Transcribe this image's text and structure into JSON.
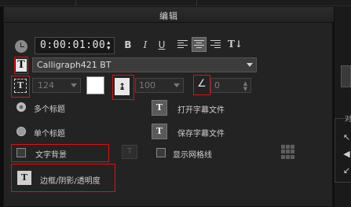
{
  "panel": {
    "title": "编辑"
  },
  "timecode": {
    "value": "0:00:01:00"
  },
  "font": {
    "selected": "Calligraph421 BT"
  },
  "size": {
    "value": "124"
  },
  "line_spacing": {
    "value": "100"
  },
  "angle": {
    "value": "0"
  },
  "titles": {
    "multi_label": "多个标题",
    "single_label": "单个标题"
  },
  "files": {
    "open_label": "打开字幕文件",
    "save_label": "保存字幕文件"
  },
  "options": {
    "text_bg_label": "文字背景",
    "grid_label": "显示网格线",
    "border_label": "边框/阴影/透明度"
  },
  "side": {
    "label": "对"
  },
  "colors": {
    "annotation": "#e01010",
    "swatch": "#ffffff"
  }
}
